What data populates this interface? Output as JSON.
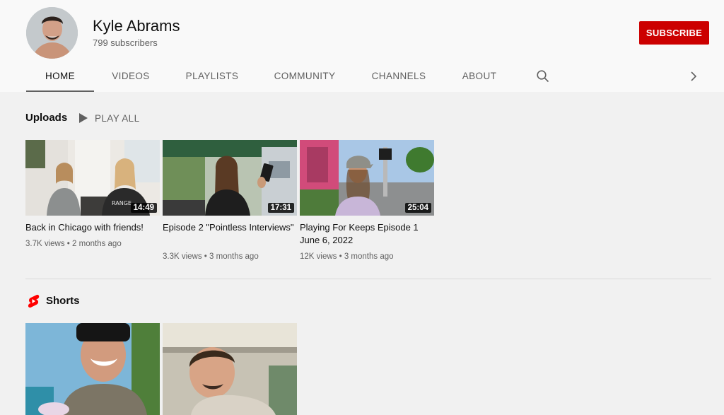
{
  "channel": {
    "name": "Kyle Abrams",
    "subscribers": "799 subscribers",
    "subscribe_label": "SUBSCRIBE",
    "accent_color": "#cc0000"
  },
  "tabs": [
    {
      "label": "HOME",
      "active": true
    },
    {
      "label": "VIDEOS",
      "active": false
    },
    {
      "label": "PLAYLISTS",
      "active": false
    },
    {
      "label": "COMMUNITY",
      "active": false
    },
    {
      "label": "CHANNELS",
      "active": false
    },
    {
      "label": "ABOUT",
      "active": false
    }
  ],
  "tab_icons": {
    "search": "search-icon",
    "next": "chevron-right-icon"
  },
  "uploads": {
    "title": "Uploads",
    "play_all_label": "PLAY ALL",
    "videos": [
      {
        "title": "Back in Chicago with friends!",
        "duration": "14:49",
        "views": "3.7K views",
        "age": "2 months ago"
      },
      {
        "title": "Episode 2 \"Pointless Interviews\"",
        "duration": "17:31",
        "views": "3.3K views",
        "age": "3 months ago"
      },
      {
        "title": "Playing For Keeps Episode 1 June 6, 2022",
        "duration": "25:04",
        "views": "12K views",
        "age": "3 months ago"
      }
    ]
  },
  "shorts": {
    "title": "Shorts",
    "icon": "shorts-icon"
  }
}
